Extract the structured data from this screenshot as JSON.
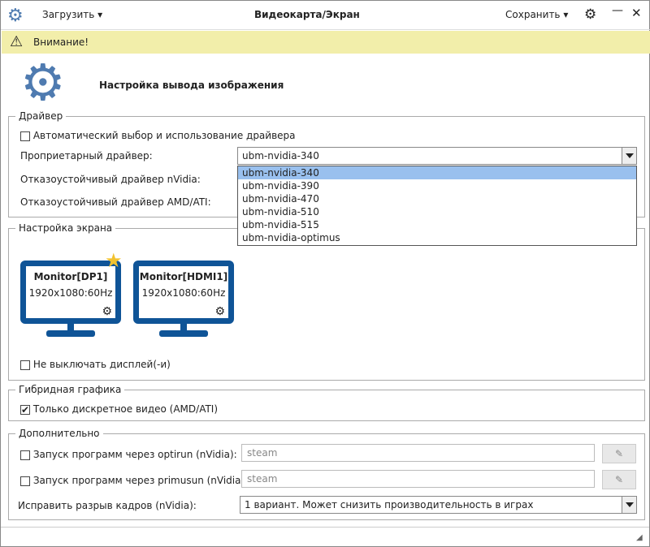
{
  "titlebar": {
    "title": "Видеокарта/Экран",
    "load": "Загрузить",
    "save": "Сохранить"
  },
  "warning": "Внимание!",
  "header": {
    "title": "Настройка вывода изображения"
  },
  "driver": {
    "legend": "Драйвер",
    "auto": "Автоматический выбор и использование драйвера",
    "proprietary_label": "Проприетарный драйвер:",
    "proprietary_value": "ubm-nvidia-340",
    "nvidia_label": "Отказоустойчивый драйвер nVidia:",
    "amd_label": "Отказоустойчивый драйвер AMD/ATI:",
    "options": [
      "ubm-nvidia-340",
      "ubm-nvidia-390",
      "ubm-nvidia-470",
      "ubm-nvidia-510",
      "ubm-nvidia-515",
      "ubm-nvidia-optimus"
    ]
  },
  "screen": {
    "legend": "Настройка экрана",
    "monitors": [
      {
        "name": "Monitor[DP1]",
        "mode": "1920x1080:60Hz"
      },
      {
        "name": "Monitor[HDMI1]",
        "mode": "1920x1080:60Hz"
      }
    ],
    "nodpms": "Не выключать дисплей(-и)"
  },
  "hybrid": {
    "legend": "Гибридная графика",
    "discrete": "Только дискретное видео (AMD/ATI)"
  },
  "extra": {
    "legend": "Дополнительно",
    "optirun": "Запуск программ через optirun (nVidia):",
    "optirun_value": "steam",
    "primusun": "Запуск программ через primusun (nVidia):",
    "primusun_value": "steam",
    "tearing_label": "Исправить разрыв кадров (nVidia):",
    "tearing_value": "1 вариант. Может снизить производительность в играх"
  }
}
